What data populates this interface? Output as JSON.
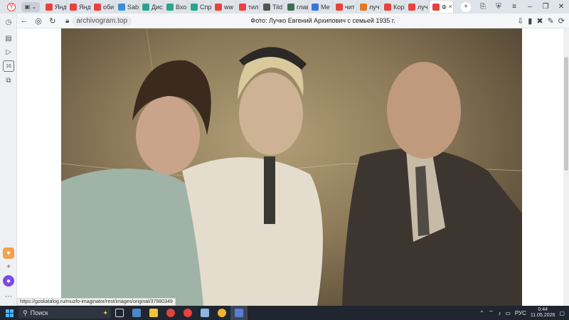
{
  "browser": {
    "tabs": [
      {
        "label": "Янд",
        "color": "#e8423f"
      },
      {
        "label": "Янд",
        "color": "#e8423f"
      },
      {
        "label": "оби",
        "color": "#e8423f"
      },
      {
        "label": "Sab",
        "color": "#3a8fd6"
      },
      {
        "label": "Дис",
        "color": "#2aa68a"
      },
      {
        "label": "Вхо",
        "color": "#2aa68a"
      },
      {
        "label": "Спр",
        "color": "#2aa68a"
      },
      {
        "label": "ww",
        "color": "#e8423f"
      },
      {
        "label": "тил",
        "color": "#e8423f"
      },
      {
        "label": "Tild",
        "color": "#555555"
      },
      {
        "label": "глав",
        "color": "#3c6e57"
      },
      {
        "label": "Ме",
        "color": "#3a74d6"
      },
      {
        "label": "чит",
        "color": "#e8423f"
      },
      {
        "label": "луч",
        "color": "#e07b2a"
      },
      {
        "label": "Кор",
        "color": "#e8423f"
      },
      {
        "label": "луч",
        "color": "#e8423f"
      }
    ],
    "active_tab": {
      "label": "Ф",
      "color": "#e8423f"
    },
    "new_tab_symbol": "+",
    "url_domain": "archivogram.top",
    "page_title": "Фото: Лучко Евгений Архипович с семьей 1935 г.",
    "status_url": "https://goskatalog.ru/muzfo-imaginator/rest/images/original/37980349"
  },
  "taskbar": {
    "search_placeholder": "Поиск",
    "language": "РУС",
    "time": "0:44",
    "date": "11.05.2026"
  },
  "photo": {
    "accent_colors": [
      "#8a7857",
      "#c2b89f",
      "#3a3833"
    ]
  },
  "icons": {
    "back": "arrow-left-icon",
    "profile": "profile-icon",
    "refresh": "refresh-icon",
    "lock": "lock-icon"
  }
}
